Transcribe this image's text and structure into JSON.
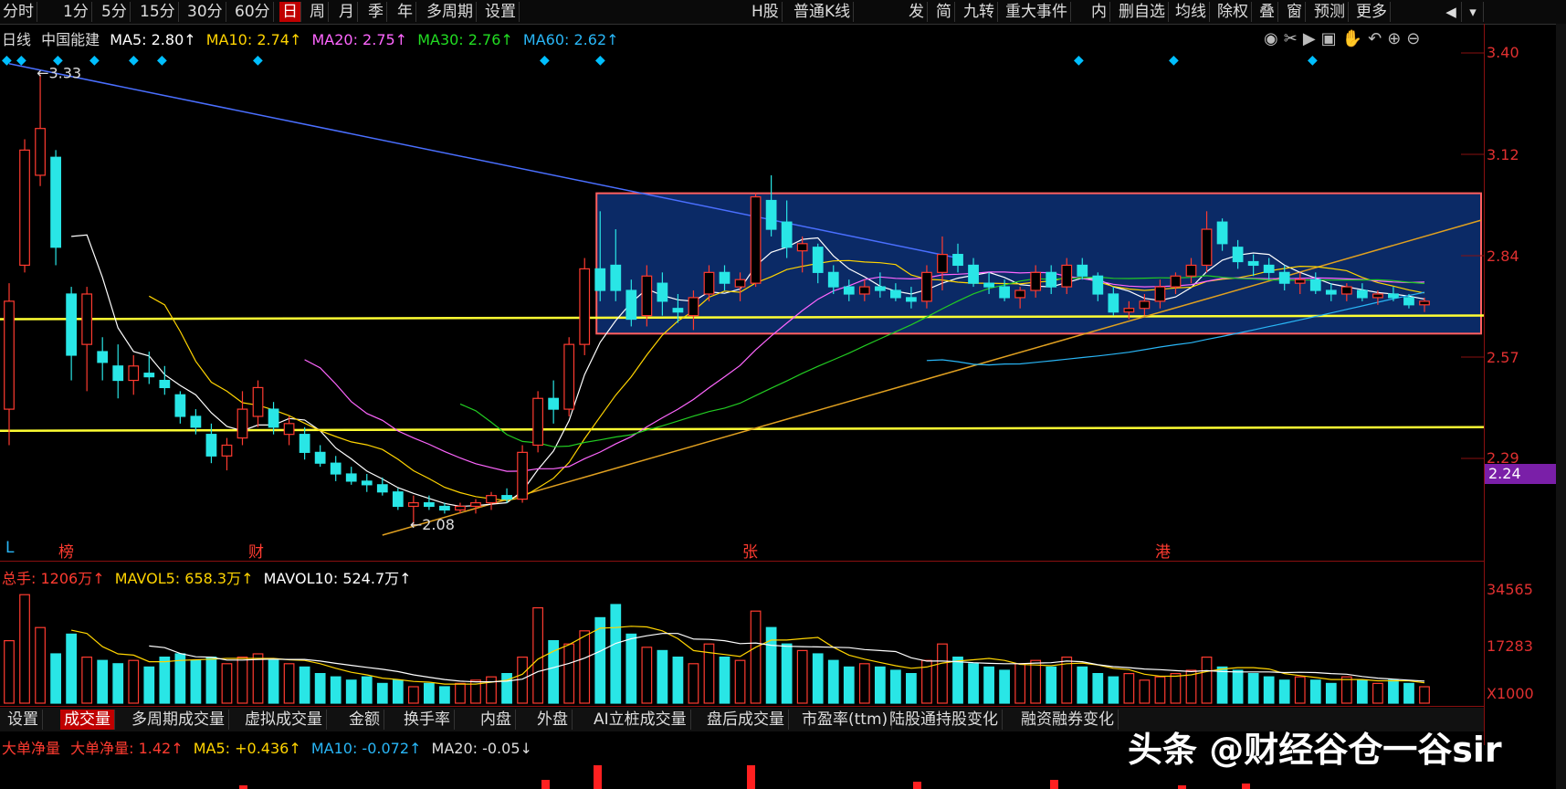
{
  "toolbar": {
    "left_tabs": [
      "分时",
      "1分",
      "5分",
      "15分",
      "30分",
      "60分",
      "日",
      "周",
      "月",
      "季",
      "年",
      "多周期",
      "设置"
    ],
    "active_tab": "日",
    "center_items": [
      "H股",
      "普通K线",
      "发",
      "简",
      "九转",
      "重大事件",
      "内",
      "删自选",
      "均线",
      "除权",
      "叠",
      "窗",
      "预测",
      "更多"
    ]
  },
  "info_row": {
    "period": "日线",
    "name": "中国能建",
    "ma5": "MA5: 2.80↑",
    "ma10": "MA10: 2.74↑",
    "ma20": "MA20: 2.75↑",
    "ma30": "MA30: 2.76↑",
    "ma60": "MA60: 2.62↑"
  },
  "price_axis": [
    "3.40",
    "3.12",
    "2.84",
    "2.57",
    "2.29"
  ],
  "current_price_badge": "2.24",
  "annotations": {
    "high": "3.33",
    "low": "2.08"
  },
  "event_labels": {
    "l": "L",
    "a": "榜",
    "b": "财",
    "c": "张",
    "d": "港"
  },
  "volume_info": {
    "total": "总手: 1206万↑",
    "mavol5": "MAVOL5: 658.3万↑",
    "mavol10": "MAVOL10: 524.7万↑"
  },
  "volume_axis": [
    "34565",
    "17283",
    "X1000"
  ],
  "bottom_tabs": [
    "设置",
    "成交量",
    "多周期成交量",
    "虚拟成交量",
    "金额",
    "换手率",
    "内盘",
    "外盘",
    "AI立桩成交量",
    "盘后成交量",
    "市盈率(ttm)",
    "陆股通持股变化",
    "融资融券变化"
  ],
  "active_bottom_tab": "成交量",
  "flow_info": {
    "title": "大单净量",
    "label": "大单净量: 1.42↑",
    "ma5": "MA5: +0.436↑",
    "ma10": "MA10: -0.072↑",
    "ma20": "MA20: -0.05↓"
  },
  "watermark": "头条 @财经谷仓一谷sir",
  "colors": {
    "up": "#ff3b30",
    "down": "#29e6e6",
    "accent": "#c00000",
    "background": "#000000"
  },
  "chart_data": {
    "type": "candlestick",
    "price_range": [
      2.05,
      3.4
    ],
    "candles": [
      [
        2.4,
        2.75,
        2.3,
        2.7
      ],
      [
        2.8,
        3.15,
        2.78,
        3.12
      ],
      [
        3.05,
        3.33,
        3.02,
        3.18
      ],
      [
        3.1,
        3.12,
        2.8,
        2.85
      ],
      [
        2.72,
        2.74,
        2.48,
        2.55
      ],
      [
        2.58,
        2.74,
        2.45,
        2.72
      ],
      [
        2.56,
        2.6,
        2.48,
        2.53
      ],
      [
        2.52,
        2.58,
        2.43,
        2.48
      ],
      [
        2.48,
        2.55,
        2.44,
        2.52
      ],
      [
        2.5,
        2.56,
        2.47,
        2.49
      ],
      [
        2.48,
        2.52,
        2.44,
        2.46
      ],
      [
        2.44,
        2.45,
        2.36,
        2.38
      ],
      [
        2.38,
        2.4,
        2.33,
        2.35
      ],
      [
        2.33,
        2.36,
        2.25,
        2.27
      ],
      [
        2.27,
        2.32,
        2.23,
        2.3
      ],
      [
        2.32,
        2.45,
        2.3,
        2.4
      ],
      [
        2.38,
        2.48,
        2.35,
        2.46
      ],
      [
        2.4,
        2.42,
        2.33,
        2.35
      ],
      [
        2.33,
        2.38,
        2.3,
        2.36
      ],
      [
        2.33,
        2.35,
        2.26,
        2.28
      ],
      [
        2.28,
        2.3,
        2.24,
        2.25
      ],
      [
        2.25,
        2.27,
        2.2,
        2.22
      ],
      [
        2.22,
        2.24,
        2.19,
        2.2
      ],
      [
        2.2,
        2.22,
        2.17,
        2.19
      ],
      [
        2.19,
        2.21,
        2.16,
        2.17
      ],
      [
        2.17,
        2.18,
        2.12,
        2.13
      ],
      [
        2.13,
        2.16,
        2.08,
        2.14
      ],
      [
        2.14,
        2.16,
        2.12,
        2.13
      ],
      [
        2.13,
        2.14,
        2.11,
        2.12
      ],
      [
        2.12,
        2.14,
        2.11,
        2.13
      ],
      [
        2.13,
        2.15,
        2.11,
        2.14
      ],
      [
        2.14,
        2.17,
        2.12,
        2.16
      ],
      [
        2.16,
        2.18,
        2.14,
        2.15
      ],
      [
        2.15,
        2.3,
        2.14,
        2.28
      ],
      [
        2.3,
        2.45,
        2.28,
        2.43
      ],
      [
        2.43,
        2.48,
        2.36,
        2.4
      ],
      [
        2.4,
        2.6,
        2.38,
        2.58
      ],
      [
        2.58,
        2.82,
        2.55,
        2.79
      ],
      [
        2.79,
        2.95,
        2.7,
        2.73
      ],
      [
        2.8,
        2.9,
        2.7,
        2.73
      ],
      [
        2.73,
        2.76,
        2.63,
        2.65
      ],
      [
        2.66,
        2.8,
        2.63,
        2.77
      ],
      [
        2.75,
        2.78,
        2.66,
        2.7
      ],
      [
        2.68,
        2.72,
        2.64,
        2.67
      ],
      [
        2.66,
        2.73,
        2.62,
        2.71
      ],
      [
        2.72,
        2.8,
        2.7,
        2.78
      ],
      [
        2.78,
        2.8,
        2.73,
        2.75
      ],
      [
        2.74,
        2.78,
        2.7,
        2.76
      ],
      [
        2.75,
        3.0,
        2.74,
        2.99
      ],
      [
        2.98,
        3.05,
        2.88,
        2.9
      ],
      [
        2.92,
        2.98,
        2.82,
        2.85
      ],
      [
        2.84,
        2.88,
        2.78,
        2.86
      ],
      [
        2.85,
        2.86,
        2.75,
        2.78
      ],
      [
        2.78,
        2.8,
        2.72,
        2.74
      ],
      [
        2.74,
        2.76,
        2.7,
        2.72
      ],
      [
        2.72,
        2.76,
        2.7,
        2.74
      ],
      [
        2.74,
        2.78,
        2.71,
        2.73
      ],
      [
        2.73,
        2.75,
        2.7,
        2.71
      ],
      [
        2.71,
        2.74,
        2.68,
        2.7
      ],
      [
        2.7,
        2.8,
        2.68,
        2.78
      ],
      [
        2.78,
        2.88,
        2.73,
        2.83
      ],
      [
        2.83,
        2.86,
        2.78,
        2.8
      ],
      [
        2.8,
        2.82,
        2.74,
        2.75
      ],
      [
        2.75,
        2.78,
        2.72,
        2.74
      ],
      [
        2.74,
        2.76,
        2.7,
        2.71
      ],
      [
        2.71,
        2.74,
        2.68,
        2.73
      ],
      [
        2.73,
        2.8,
        2.71,
        2.78
      ],
      [
        2.78,
        2.8,
        2.72,
        2.74
      ],
      [
        2.74,
        2.82,
        2.72,
        2.8
      ],
      [
        2.8,
        2.82,
        2.76,
        2.77
      ],
      [
        2.77,
        2.78,
        2.7,
        2.72
      ],
      [
        2.72,
        2.74,
        2.66,
        2.67
      ],
      [
        2.67,
        2.7,
        2.65,
        2.68
      ],
      [
        2.68,
        2.72,
        2.66,
        2.7
      ],
      [
        2.7,
        2.76,
        2.68,
        2.74
      ],
      [
        2.74,
        2.78,
        2.72,
        2.77
      ],
      [
        2.77,
        2.82,
        2.75,
        2.8
      ],
      [
        2.8,
        2.95,
        2.78,
        2.9
      ],
      [
        2.92,
        2.93,
        2.84,
        2.86
      ],
      [
        2.85,
        2.87,
        2.79,
        2.81
      ],
      [
        2.81,
        2.83,
        2.77,
        2.8
      ],
      [
        2.8,
        2.82,
        2.76,
        2.78
      ],
      [
        2.78,
        2.8,
        2.73,
        2.75
      ],
      [
        2.75,
        2.78,
        2.72,
        2.76
      ],
      [
        2.76,
        2.78,
        2.72,
        2.73
      ],
      [
        2.73,
        2.75,
        2.7,
        2.72
      ],
      [
        2.72,
        2.75,
        2.7,
        2.74
      ],
      [
        2.73,
        2.75,
        2.7,
        2.71
      ],
      [
        2.71,
        2.73,
        2.69,
        2.72
      ],
      [
        2.72,
        2.74,
        2.7,
        2.71
      ],
      [
        2.71,
        2.72,
        2.68,
        2.69
      ],
      [
        2.69,
        2.71,
        2.67,
        2.7
      ]
    ],
    "volume": [
      1900,
      3300,
      2300,
      1500,
      2100,
      1400,
      1300,
      1200,
      1300,
      1100,
      1400,
      1500,
      1300,
      1400,
      1200,
      1400,
      1500,
      1300,
      1200,
      1100,
      900,
      800,
      700,
      800,
      600,
      700,
      500,
      600,
      500,
      600,
      700,
      800,
      900,
      1400,
      2900,
      1900,
      1800,
      2200,
      2600,
      3000,
      2100,
      1700,
      1600,
      1400,
      1200,
      1800,
      1400,
      1300,
      2800,
      2300,
      1800,
      1600,
      1500,
      1300,
      1100,
      1200,
      1100,
      1000,
      900,
      1300,
      1800,
      1400,
      1200,
      1100,
      1000,
      1200,
      1300,
      1100,
      1400,
      1100,
      900,
      800,
      900,
      700,
      800,
      900,
      1000,
      1400,
      1100,
      1000,
      900,
      800,
      700,
      800,
      700,
      600,
      800,
      700,
      600,
      700,
      600,
      500
    ],
    "horizontal_lines": [
      2.65,
      2.34
    ],
    "box": {
      "x_start_index": 38,
      "x_end_index": 91,
      "price_high": 3.0,
      "price_low": 2.61
    },
    "trend_lines": [
      {
        "name": "downtrend",
        "from": [
          0,
          3.36
        ],
        "to": [
          61,
          2.82
        ]
      },
      {
        "name": "uptrend",
        "from": [
          24,
          2.05
        ],
        "to": [
          91,
          2.88
        ]
      }
    ]
  }
}
